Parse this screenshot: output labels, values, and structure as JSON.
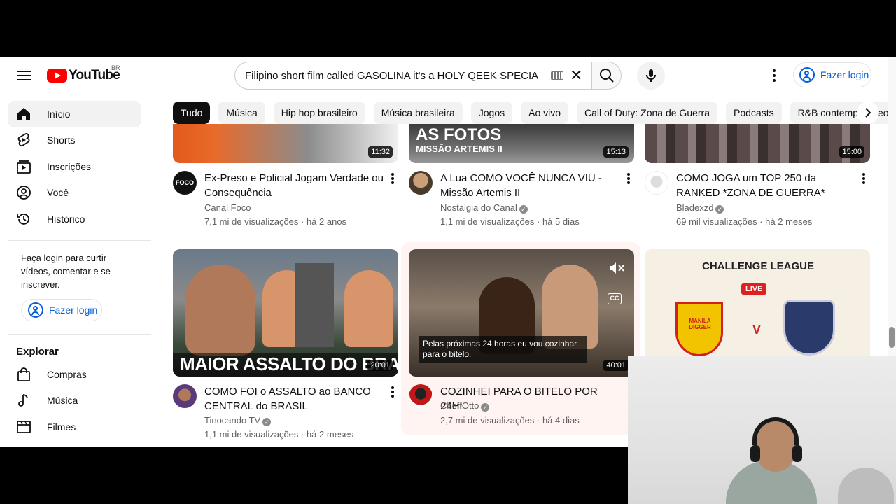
{
  "masthead": {
    "logo_text": "YouTube",
    "country_code": "BR",
    "search_query": "Filipino short film called GASOLINA it's a HOLY QEEK SPECIAL",
    "login_label": "Fazer login"
  },
  "chips": [
    "Tudo",
    "Música",
    "Hip hop brasileiro",
    "Música brasileira",
    "Jogos",
    "Ao vivo",
    "Call of Duty: Zona de Guerra",
    "Podcasts",
    "R&B contemporâneo"
  ],
  "sidebar": {
    "items": [
      {
        "label": "Início",
        "icon": "home-icon"
      },
      {
        "label": "Shorts",
        "icon": "shorts-icon"
      },
      {
        "label": "Inscrições",
        "icon": "subscriptions-icon"
      },
      {
        "label": "Você",
        "icon": "you-icon"
      },
      {
        "label": "Histórico",
        "icon": "history-icon"
      }
    ],
    "signin_text": "Faça login para curtir vídeos, comentar e se inscrever.",
    "login_label": "Fazer login",
    "explore_title": "Explorar",
    "explore_items": [
      {
        "label": "Compras",
        "icon": "shopping-icon"
      },
      {
        "label": "Música",
        "icon": "music-icon"
      },
      {
        "label": "Filmes",
        "icon": "film-icon"
      }
    ]
  },
  "videos_row1": [
    {
      "title": "Ex-Preso e Policial Jogam Verdade ou Consequência",
      "channel": "Canal Foco",
      "verified": false,
      "stats": "7,1 mi de visualizações · há 2 anos",
      "duration": "11:32",
      "avatar_text": "FOCO"
    },
    {
      "title": "A Lua COMO VOCÊ NUNCA VIU - Missão Artemis II",
      "channel": "Nostalgia do Canal",
      "verified": true,
      "stats": "1,1 mi de visualizações · há 5 dias",
      "duration": "15:13",
      "thumb_text": "AS FOTOS",
      "thumb_subtext": "MISSÃO ARTEMIS II"
    },
    {
      "title": "COMO JOGA um TOP 250 da RANKED *ZONA DE GUERRA*",
      "channel": "Bladexzd",
      "verified": true,
      "stats": "69 mil visualizações · há 2 meses",
      "duration": "15:00"
    }
  ],
  "videos_row2": [
    {
      "title": "COMO FOI o ASSALTO ao BANCO CENTRAL do BRASIL",
      "channel": "Tinocando TV",
      "verified": true,
      "stats": "1,1 mi de visualizações · há 2 meses",
      "duration": "20:01",
      "thumb_text": "MAIOR ASSALTO DO BRASIL"
    },
    {
      "title": "COZINHEI PARA O BITELO POR 24H!",
      "channel": "CheffOtto",
      "verified": true,
      "stats": "2,7 mi de visualizações · há 4 dias",
      "duration": "40:01",
      "caption": "Pelas próximas 24 horas eu vou cozinhar para o bitelo.",
      "cc_label": "CC"
    },
    {
      "title": "",
      "thumb_text": "CHALLENGE LEAGUE",
      "live_label": "LIVE",
      "team1": "MANILA DIGGER",
      "vs": "V"
    }
  ],
  "colors": {
    "accent": "#065fd4",
    "brand": "#ff0000",
    "chip_active": "#0f0f0f",
    "chip_bg": "#f2f2f2"
  }
}
